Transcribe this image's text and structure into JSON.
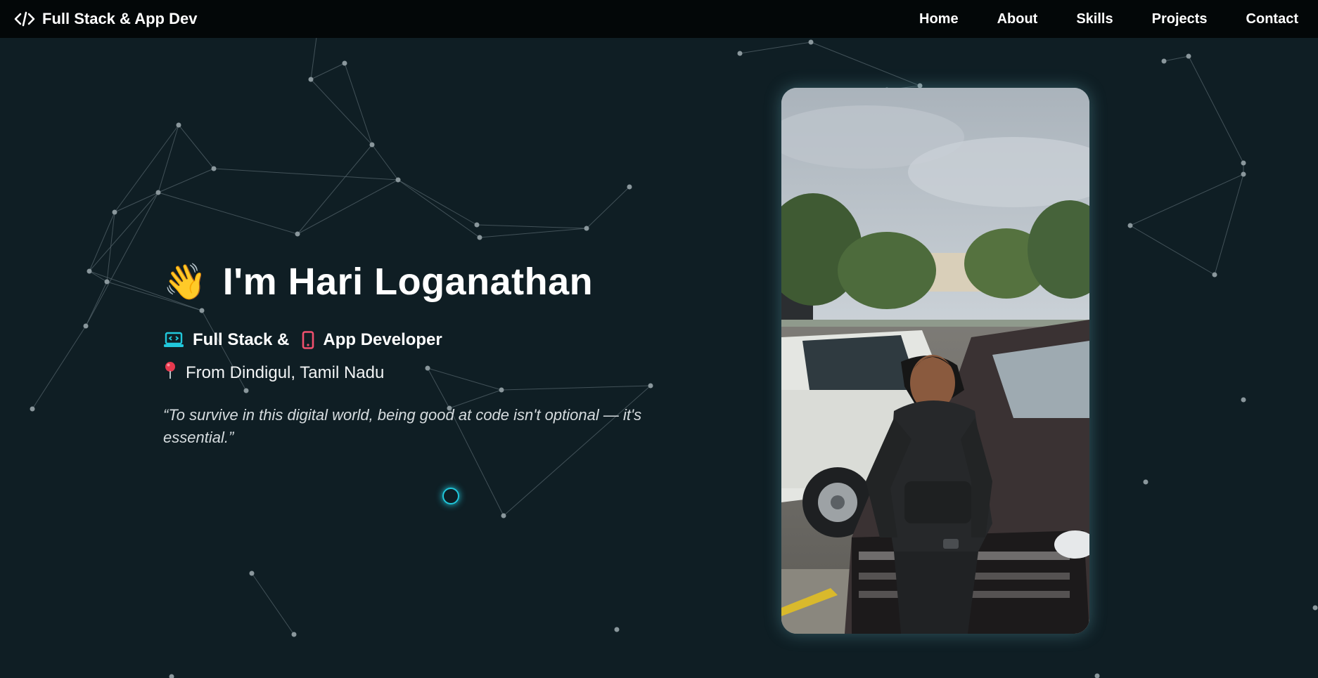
{
  "navbar": {
    "brand_icon": "code-icon",
    "brand": "Full Stack & App Dev",
    "links": [
      {
        "label": "Home"
      },
      {
        "label": "About"
      },
      {
        "label": "Skills"
      },
      {
        "label": "Projects"
      },
      {
        "label": "Contact"
      }
    ]
  },
  "hero": {
    "wave_icon": "waving-hand-icon",
    "wave_glyph": "👋",
    "title": "I'm Hari Loganathan",
    "role_part1": "Full Stack &",
    "role_part2": "App Developer",
    "role_icons": [
      "laptop-code-icon",
      "mobile-phone-icon"
    ],
    "location_icon": "location-pin-icon",
    "location": "From Dindigul, Tamil Nadu",
    "quote": "“To survive in this digital world, being good at code isn't optional — it's essential.”"
  },
  "profile_photo": {
    "subject": "profile-photo"
  },
  "colors": {
    "background": "#0f1e24",
    "navbar": "#030708",
    "accent_cyan": "#21c8dc",
    "accent_pink": "#f0506e",
    "network_line": "#53636a",
    "network_node": "#8a979c"
  }
}
